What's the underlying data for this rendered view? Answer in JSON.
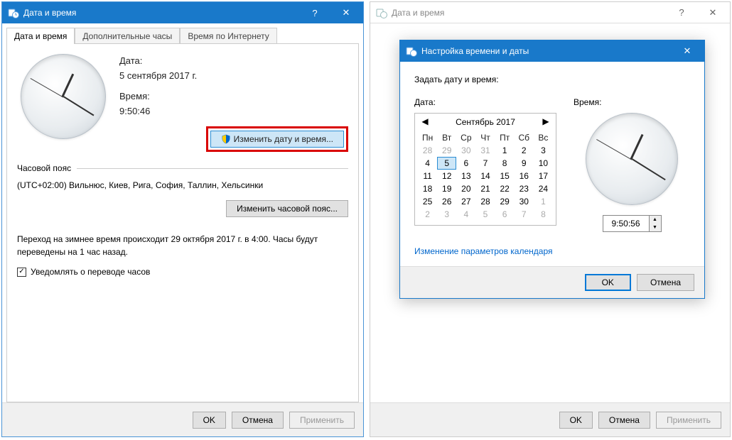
{
  "win1": {
    "title": "Дата и время",
    "tabs": [
      "Дата и время",
      "Дополнительные часы",
      "Время по Интернету"
    ],
    "date_label": "Дата:",
    "date_value": "5 сентября 2017 г.",
    "time_label": "Время:",
    "time_value": "9:50:46",
    "change_dt_btn": "Изменить дату и время...",
    "tz_heading": "Часовой пояс",
    "tz_value": "(UTC+02:00) Вильнюс, Киев, Рига, София, Таллин, Хельсинки",
    "change_tz_btn": "Изменить часовой пояс...",
    "dst_text": "Переход на зимнее время происходит 29 октября 2017 г. в 4:00. Часы будут переведены на 1 час назад.",
    "notify_label": "Уведомлять о переводе часов",
    "ok": "OK",
    "cancel": "Отмена",
    "apply": "Применить"
  },
  "win2": {
    "title": "Дата и время",
    "ok": "OK",
    "cancel": "Отмена",
    "apply": "Применить"
  },
  "dialog": {
    "title": "Настройка времени и даты",
    "prompt": "Задать дату и время:",
    "date_label": "Дата:",
    "time_label": "Время:",
    "cal_title": "Сентябрь 2017",
    "dow": [
      "Пн",
      "Вт",
      "Ср",
      "Чт",
      "Пт",
      "Сб",
      "Вс"
    ],
    "weeks": [
      [
        {
          "d": 28,
          "o": true
        },
        {
          "d": 29,
          "o": true
        },
        {
          "d": 30,
          "o": true
        },
        {
          "d": 31,
          "o": true
        },
        {
          "d": 1
        },
        {
          "d": 2
        },
        {
          "d": 3
        }
      ],
      [
        {
          "d": 4
        },
        {
          "d": 5,
          "sel": true
        },
        {
          "d": 6
        },
        {
          "d": 7
        },
        {
          "d": 8
        },
        {
          "d": 9
        },
        {
          "d": 10
        }
      ],
      [
        {
          "d": 11
        },
        {
          "d": 12
        },
        {
          "d": 13
        },
        {
          "d": 14
        },
        {
          "d": 15
        },
        {
          "d": 16
        },
        {
          "d": 17
        }
      ],
      [
        {
          "d": 18
        },
        {
          "d": 19
        },
        {
          "d": 20
        },
        {
          "d": 21
        },
        {
          "d": 22
        },
        {
          "d": 23
        },
        {
          "d": 24
        }
      ],
      [
        {
          "d": 25
        },
        {
          "d": 26
        },
        {
          "d": 27
        },
        {
          "d": 28
        },
        {
          "d": 29
        },
        {
          "d": 30
        },
        {
          "d": 1,
          "o": true
        }
      ],
      [
        {
          "d": 2,
          "o": true
        },
        {
          "d": 3,
          "o": true
        },
        {
          "d": 4,
          "o": true
        },
        {
          "d": 5,
          "o": true
        },
        {
          "d": 6,
          "o": true
        },
        {
          "d": 7,
          "o": true
        },
        {
          "d": 8,
          "o": true
        }
      ]
    ],
    "time_value": "9:50:56",
    "link": "Изменение параметров календаря",
    "ok": "OK",
    "cancel": "Отмена"
  },
  "clock_hands": {
    "hour_deg": -65,
    "minute_deg": 32,
    "second_deg": 210
  }
}
